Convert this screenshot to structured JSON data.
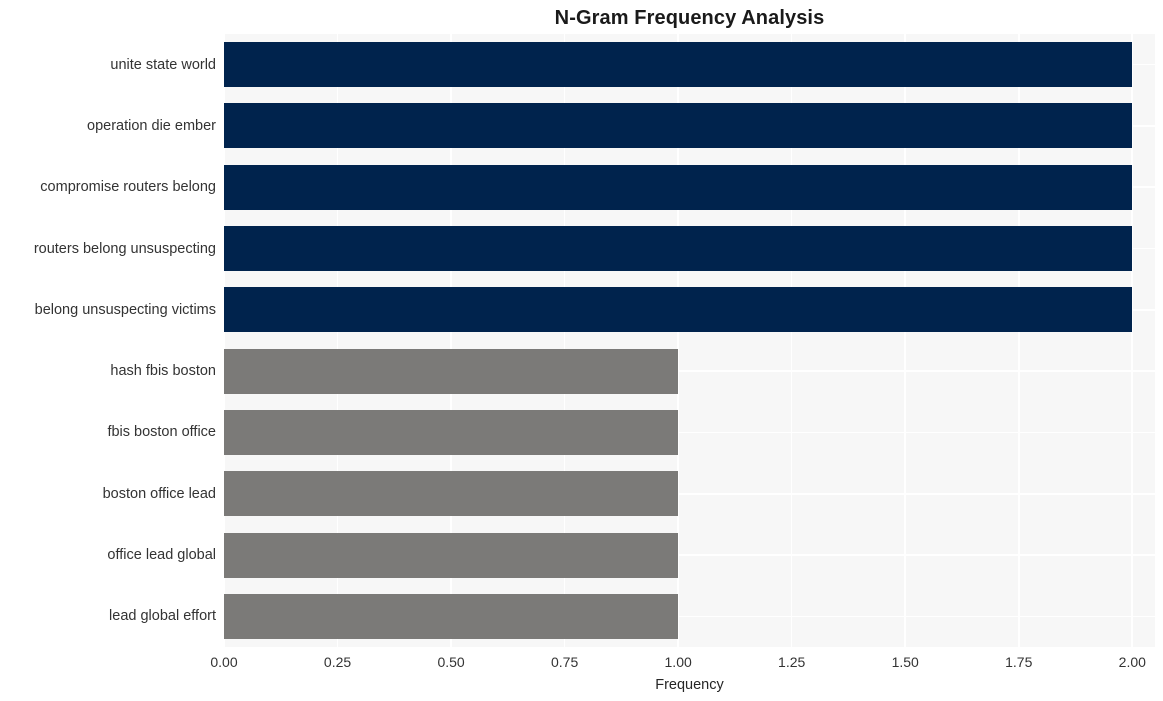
{
  "chart_data": {
    "type": "bar",
    "orientation": "horizontal",
    "title": "N-Gram Frequency Analysis",
    "xlabel": "Frequency",
    "ylabel": "",
    "xlim": [
      0.0,
      2.05
    ],
    "xticks": [
      "0.00",
      "0.25",
      "0.50",
      "0.75",
      "1.00",
      "1.25",
      "1.50",
      "1.75",
      "2.00"
    ],
    "xtick_values": [
      0.0,
      0.25,
      0.5,
      0.75,
      1.0,
      1.25,
      1.5,
      1.75,
      2.0
    ],
    "grid": true,
    "legend": null,
    "categories": [
      "unite state world",
      "operation die ember",
      "compromise routers belong",
      "routers belong unsuspecting",
      "belong unsuspecting victims",
      "hash fbis boston",
      "fbis boston office",
      "boston office lead",
      "office lead global",
      "lead global effort"
    ],
    "values": [
      2,
      2,
      2,
      2,
      2,
      1,
      1,
      1,
      1,
      1
    ],
    "bar_colors": [
      "#00234d",
      "#00234d",
      "#00234d",
      "#00234d",
      "#00234d",
      "#7b7a78",
      "#7b7a78",
      "#7b7a78",
      "#7b7a78",
      "#7b7a78"
    ],
    "colors": {
      "high_frequency_bar": "#00234d",
      "low_frequency_bar": "#7b7a78",
      "plot_background": "#f7f7f7",
      "grid_line": "#ffffff",
      "figure_background": "#ffffff",
      "text": "#333333"
    }
  }
}
